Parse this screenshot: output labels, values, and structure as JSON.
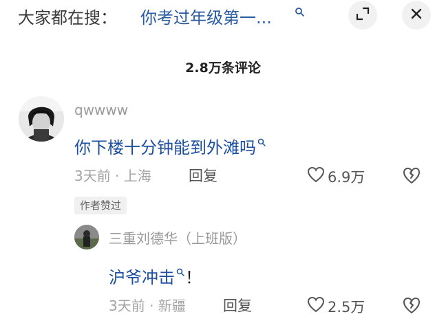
{
  "header": {
    "search_prefix": "大家都在搜：",
    "search_query": "你考过年级第一...",
    "expand_icon": "expand-icon",
    "close_icon": "close-icon"
  },
  "comment_count": "2.8万条评论",
  "comments": [
    {
      "username": "qwwww",
      "text": "你下楼十分钟能到外滩吗",
      "time_location": "3天前 · 上海",
      "reply_label": "回复",
      "like_count": "6.9万",
      "author_tag": "作者赞过"
    }
  ],
  "replies": [
    {
      "username": "三重刘德华（上班版）",
      "text": "沪爷冲击",
      "text_suffix": "！",
      "time_location": "3天前 · 新疆",
      "reply_label": "回复",
      "like_count": "2.5万"
    }
  ],
  "colors": {
    "link_blue": "#1d4fa0",
    "meta_gray": "#a3a3a3",
    "button_bg": "#f1f1f1"
  }
}
